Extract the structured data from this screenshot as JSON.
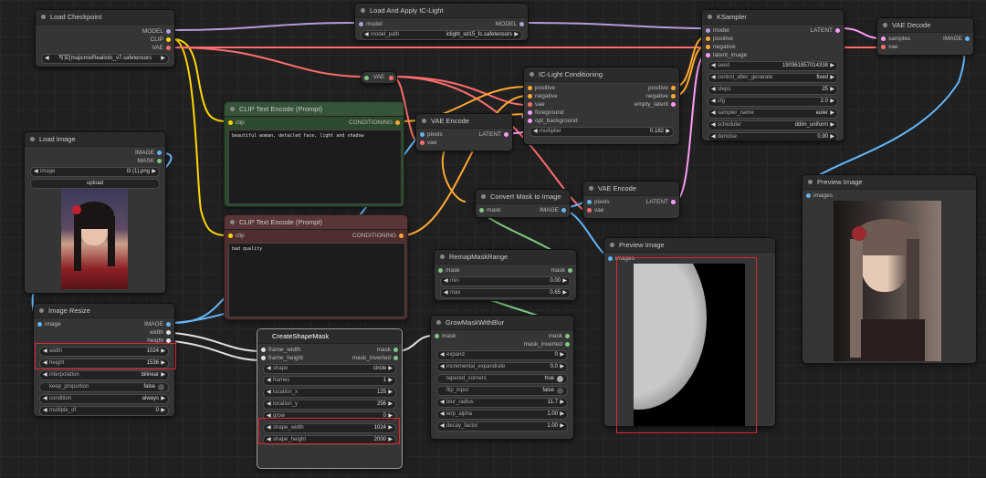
{
  "nodes": {
    "load_checkpoint": {
      "title": "Load Checkpoint",
      "outputs": [
        "MODEL",
        "CLIP",
        "VAE"
      ],
      "ckpt_value": "写实[majicmixRealistic_v7.safetensors"
    },
    "load_iclight": {
      "title": "Load And Apply IC-Light",
      "input": "model",
      "output": "MODEL",
      "model_path_label": "model_path",
      "model_path_value": "iclight_sd15_fc.safetensors"
    },
    "ksampler": {
      "title": "KSampler",
      "inputs": [
        "model",
        "positive",
        "negative",
        "latent_image"
      ],
      "output": "LATENT",
      "widgets": [
        {
          "label": "seed",
          "value": "190361857014338"
        },
        {
          "label": "control_after_generate",
          "value": "fixed"
        },
        {
          "label": "steps",
          "value": "25"
        },
        {
          "label": "cfg",
          "value": "2.0"
        },
        {
          "label": "sampler_name",
          "value": "euler"
        },
        {
          "label": "scheduler",
          "value": "ddim_uniform"
        },
        {
          "label": "denoise",
          "value": "0.90"
        }
      ]
    },
    "vae_decode": {
      "title": "VAE Decode",
      "inputs": [
        "samples",
        "vae"
      ],
      "output": "IMAGE"
    },
    "vae_reroute": {
      "label": "VAE"
    },
    "iclight_cond": {
      "title": "IC-Light Conditioning",
      "inputs": [
        "positive",
        "negative",
        "vae",
        "foreground",
        "opt_background"
      ],
      "outputs": [
        "positive",
        "negative",
        "empty_latent"
      ],
      "multiplier_label": "multiplier",
      "multiplier_value": "0.182"
    },
    "clip_pos": {
      "title": "CLIP Text Encode (Prompt)",
      "input": "clip",
      "output": "CONDITIONING",
      "text": "beautiful woman, detailed face, light and shadow"
    },
    "clip_neg": {
      "title": "CLIP Text Encode (Prompt)",
      "input": "clip",
      "output": "CONDITIONING",
      "text": "bad quality"
    },
    "vae_encode1": {
      "title": "VAE Encode",
      "inputs": [
        "pixels",
        "vae"
      ],
      "output": "LATENT"
    },
    "vae_encode2": {
      "title": "VAE Encode",
      "inputs": [
        "pixels",
        "vae"
      ],
      "output": "LATENT"
    },
    "load_image": {
      "title": "Load Image",
      "outputs": [
        "IMAGE",
        "MASK"
      ],
      "image_label": "image",
      "image_value": "i3 (1).png",
      "upload_label": "upload"
    },
    "convert_mask": {
      "title": "Convert Mask to Image",
      "input": "mask",
      "output": "IMAGE"
    },
    "preview_image_right": {
      "title": "Preview Image",
      "input": "images"
    },
    "preview_image_mid": {
      "title": "Preview Image",
      "input": "images"
    },
    "remap_mask": {
      "title": "RemapMaskRange",
      "input": "mask",
      "output": "mask",
      "widgets": [
        {
          "label": "min",
          "value": "0.00"
        },
        {
          "label": "max",
          "value": "0.65"
        }
      ]
    },
    "image_resize": {
      "title": "Image Resize",
      "input": "image",
      "outputs": [
        "IMAGE",
        "width",
        "height"
      ],
      "widgets": [
        {
          "label": "width",
          "value": "1024"
        },
        {
          "label": "height",
          "value": "1536"
        },
        {
          "label": "interpolation",
          "value": "bilinear"
        },
        {
          "label": "keep_proportion",
          "value": "false"
        },
        {
          "label": "condition",
          "value": "always"
        },
        {
          "label": "multiple_of",
          "value": "0"
        }
      ]
    },
    "create_shape_mask": {
      "title": "CreateShapeMask",
      "inputs": [
        "frame_width",
        "frame_height"
      ],
      "outputs": [
        "mask",
        "mask_inverted"
      ],
      "widgets": [
        {
          "label": "shape",
          "value": "circle"
        },
        {
          "label": "frames",
          "value": "1"
        },
        {
          "label": "location_x",
          "value": "125"
        },
        {
          "label": "location_y",
          "value": "256"
        },
        {
          "label": "grow",
          "value": "0"
        },
        {
          "label": "shape_width",
          "value": "1024"
        },
        {
          "label": "shape_height",
          "value": "2000"
        }
      ]
    },
    "grow_mask_blur": {
      "title": "GrowMaskWithBlur",
      "input": "mask",
      "outputs": [
        "mask",
        "mask_inverted"
      ],
      "widgets": [
        {
          "label": "expand",
          "value": "0"
        },
        {
          "label": "incremental_expandrate",
          "value": "0.0"
        },
        {
          "label": "tapered_corners",
          "value": "true"
        },
        {
          "label": "flip_input",
          "value": "false"
        },
        {
          "label": "blur_radius",
          "value": "11.7"
        },
        {
          "label": "lerp_alpha",
          "value": "1.00"
        },
        {
          "label": "decay_factor",
          "value": "1.00"
        }
      ]
    }
  },
  "colors": {
    "model": "#b39ddb",
    "clip": "#ffd500",
    "vae": "#ff6e6e",
    "conditioning": "#ffa931",
    "latent": "#ff9cf9",
    "image": "#64b5f6",
    "mask": "#81c784",
    "int": "#e0e0e0"
  }
}
